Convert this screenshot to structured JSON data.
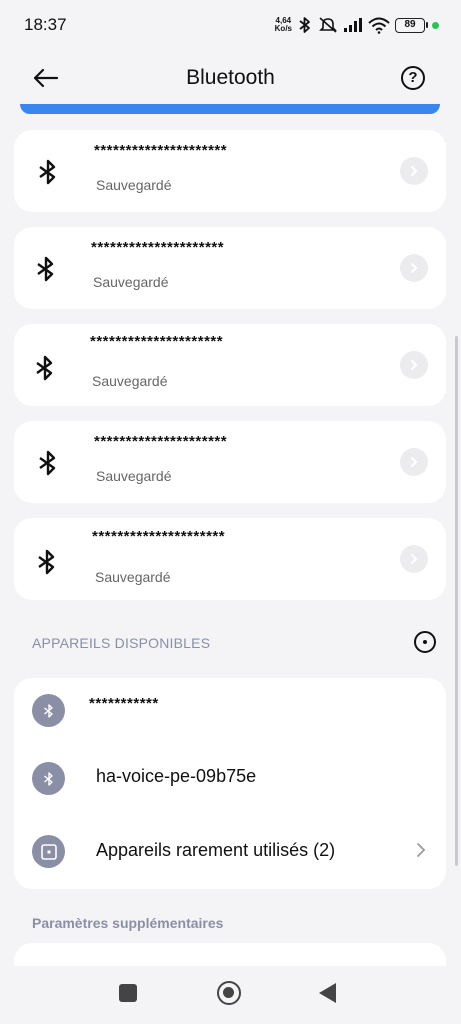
{
  "status_bar": {
    "time": "18:37",
    "net_speed_value": "4,64",
    "net_speed_unit": "Ko/s",
    "battery": "89",
    "icons": [
      "bluetooth-icon",
      "mute-icon",
      "signal-icon",
      "wifi-icon",
      "battery-icon",
      "green-dot"
    ]
  },
  "header": {
    "title": "Bluetooth",
    "back_icon": "arrow-left-icon",
    "help_label": "?"
  },
  "saved_devices": [
    {
      "name": "*********************",
      "status": "Sauvegardé"
    },
    {
      "name": "*********************",
      "status": "Sauvegardé"
    },
    {
      "name": "*********************",
      "status": "Sauvegardé"
    },
    {
      "name": "*********************",
      "status": "Sauvegardé"
    },
    {
      "name": "*********************",
      "status": "Sauvegardé"
    }
  ],
  "available": {
    "section_label": "APPAREILS DISPONIBLES",
    "items": [
      {
        "name": "***********",
        "icon": "bluetooth-icon"
      },
      {
        "name": "ha-voice-pe-09b75e",
        "icon": "bluetooth-icon"
      },
      {
        "name": "Appareils rarement utilisés (2)",
        "icon": "square-icon"
      }
    ]
  },
  "extra": {
    "section_label": "Paramètres supplémentaires"
  },
  "colors": {
    "accent": "#3a86ef",
    "section_text": "#8a8fa6",
    "icon_bg": "#8a8fa6",
    "background": "#f4f4f6"
  }
}
